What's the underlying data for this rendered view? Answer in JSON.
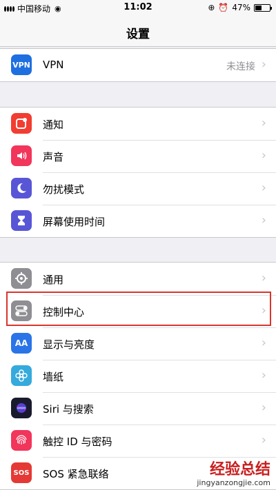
{
  "status_bar": {
    "carrier": "中国移动",
    "time": "11:02",
    "battery": "47%"
  },
  "nav": {
    "title": "设置"
  },
  "groups": [
    [
      {
        "label": "VPN",
        "value": "未连接",
        "icon": "vpn-icon",
        "icon_text": "VPN",
        "color": "#1e6fe0"
      }
    ],
    [
      {
        "label": "通知",
        "icon": "notification-icon",
        "color": "#f23d31"
      },
      {
        "label": "声音",
        "icon": "sound-icon",
        "color": "#f2355b"
      },
      {
        "label": "勿扰模式",
        "icon": "moon-icon",
        "color": "#5856d6"
      },
      {
        "label": "屏幕使用时间",
        "icon": "hourglass-icon",
        "color": "#5856d6"
      }
    ],
    [
      {
        "label": "通用",
        "icon": "gear-icon",
        "color": "#8e8e93"
      },
      {
        "label": "控制中心",
        "icon": "switch-icon",
        "color": "#8e8e93"
      },
      {
        "label": "显示与亮度",
        "icon": "display-icon",
        "icon_text": "AA",
        "color": "#2a74e8"
      },
      {
        "label": "墙纸",
        "icon": "wallpaper-icon",
        "color": "#35aadc"
      },
      {
        "label": "Siri 与搜索",
        "icon": "siri-icon",
        "color": "#1a1a2e"
      },
      {
        "label": "触控 ID 与密码",
        "icon": "fingerprint-icon",
        "color": "#f2355b"
      },
      {
        "label": "SOS 紧急联络",
        "icon": "sos-icon",
        "icon_text": "SOS",
        "color": "#e53935"
      }
    ]
  ],
  "watermark": {
    "line1": "经验总结",
    "line2": "jingyanzongjie.com"
  }
}
